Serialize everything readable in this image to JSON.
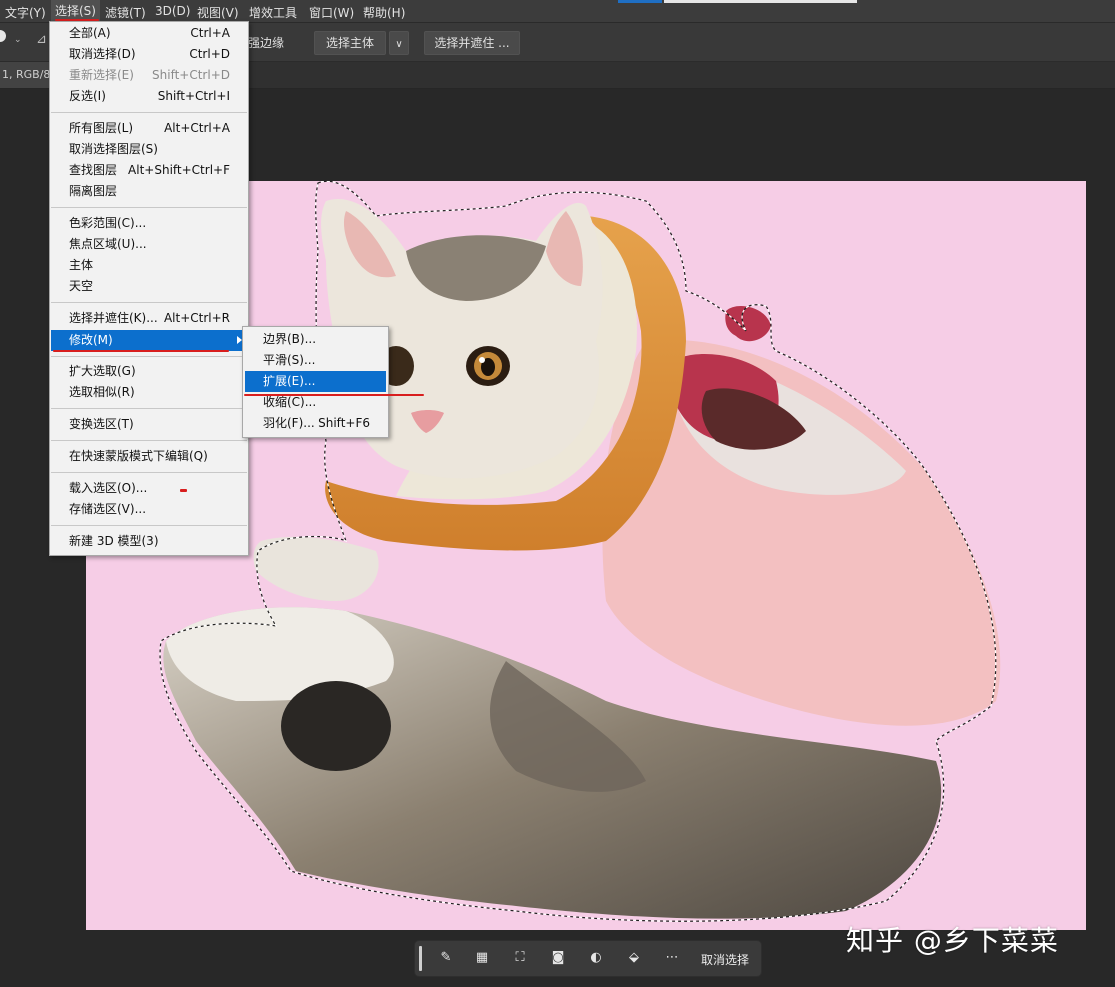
{
  "menubar": {
    "items": [
      "文字(Y)",
      "选择(S)",
      "滤镜(T)",
      "3D(D)",
      "视图(V)",
      "增效工具",
      "窗口(W)",
      "帮助(H)"
    ]
  },
  "options": {
    "refine_edge_label": "强边缘",
    "select_subject": "选择主体",
    "select_and_mask": "选择并遮住 ..."
  },
  "doc_tab": {
    "title": "1, RGB/8"
  },
  "select_menu": {
    "items": [
      {
        "label": "全部(A)",
        "shortcut": "Ctrl+A"
      },
      {
        "label": "取消选择(D)",
        "shortcut": "Ctrl+D"
      },
      {
        "label": "重新选择(E)",
        "shortcut": "Shift+Ctrl+D"
      },
      {
        "label": "反选(I)",
        "shortcut": "Shift+Ctrl+I"
      },
      {
        "label": "所有图层(L)",
        "shortcut": "Alt+Ctrl+A"
      },
      {
        "label": "取消选择图层(S)",
        "shortcut": ""
      },
      {
        "label": "查找图层",
        "shortcut": "Alt+Shift+Ctrl+F"
      },
      {
        "label": "隔离图层",
        "shortcut": ""
      },
      {
        "label": "色彩范围(C)...",
        "shortcut": ""
      },
      {
        "label": "焦点区域(U)...",
        "shortcut": ""
      },
      {
        "label": "主体",
        "shortcut": ""
      },
      {
        "label": "天空",
        "shortcut": ""
      },
      {
        "label": "选择并遮住(K)...",
        "shortcut": "Alt+Ctrl+R"
      },
      {
        "label": "修改(M)",
        "shortcut": ""
      },
      {
        "label": "扩大选取(G)",
        "shortcut": ""
      },
      {
        "label": "选取相似(R)",
        "shortcut": ""
      },
      {
        "label": "变换选区(T)",
        "shortcut": ""
      },
      {
        "label": "在快速蒙版模式下编辑(Q)",
        "shortcut": ""
      },
      {
        "label": "载入选区(O)...",
        "shortcut": ""
      },
      {
        "label": "存储选区(V)...",
        "shortcut": ""
      },
      {
        "label": "新建 3D 模型(3)",
        "shortcut": ""
      }
    ]
  },
  "modify_submenu": {
    "items": [
      {
        "label": "边界(B)...",
        "shortcut": ""
      },
      {
        "label": "平滑(S)...",
        "shortcut": ""
      },
      {
        "label": "扩展(E)...",
        "shortcut": ""
      },
      {
        "label": "收缩(C)...",
        "shortcut": ""
      },
      {
        "label": "羽化(F)...",
        "shortcut": "Shift+F6"
      }
    ]
  },
  "taskbar": {
    "deselect_label": "取消选择",
    "icons": [
      "brush-icon",
      "checker-mask-icon",
      "transform-icon",
      "mask-icon",
      "adjustment-icon",
      "fill-icon",
      "more-icon"
    ]
  },
  "watermark": "知乎 @乡下菜菜",
  "colors": {
    "canvas_bg": "#f6cde6",
    "highlight": "#0c6fcd",
    "annotation_red": "#d81e1e"
  }
}
